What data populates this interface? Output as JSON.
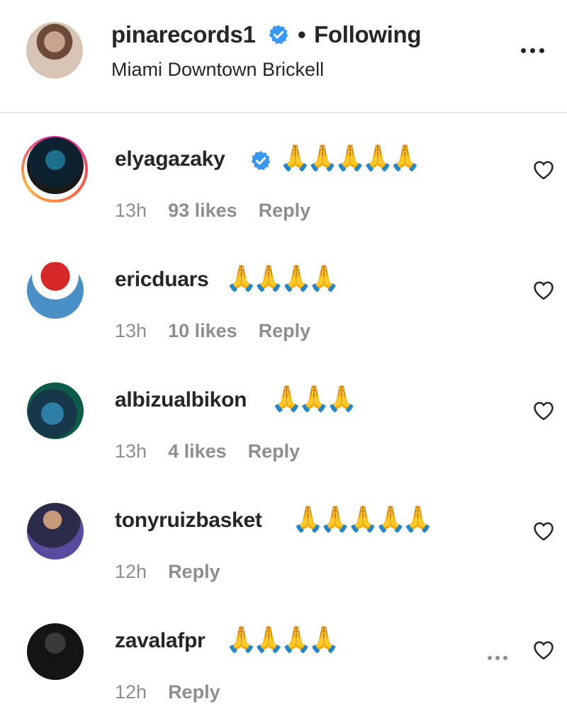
{
  "header": {
    "username": "pinarecords1",
    "separator": "•",
    "follow_status": "Following",
    "location": "Miami Downtown Brickell",
    "more_icon": "more-horizontal-icon"
  },
  "comments": [
    {
      "username": "elyagazaky",
      "verified": true,
      "text": "🙏🙏🙏🙏🙏",
      "time": "13h",
      "likes": "93 likes",
      "reply": "Reply",
      "has_story": true
    },
    {
      "username": "ericduars",
      "verified": false,
      "text": "🙏🙏🙏🙏",
      "time": "13h",
      "likes": "10 likes",
      "reply": "Reply"
    },
    {
      "username": "albizualbikon",
      "verified": false,
      "text": "🙏🙏🙏",
      "time": "13h",
      "likes": "4 likes",
      "reply": "Reply"
    },
    {
      "username": "tonyruizbasket",
      "verified": false,
      "text": "🙏🙏🙏🙏🙏",
      "time": "12h",
      "likes": "",
      "reply": "Reply"
    },
    {
      "username": "zavalafpr",
      "verified": false,
      "text": "🙏🙏🙏🙏",
      "time": "12h",
      "likes": "",
      "reply": "Reply",
      "show_more": true
    }
  ],
  "colors": {
    "verified": "#3897f0",
    "meta_text": "#8e8e8e",
    "primary_text": "#262626"
  }
}
